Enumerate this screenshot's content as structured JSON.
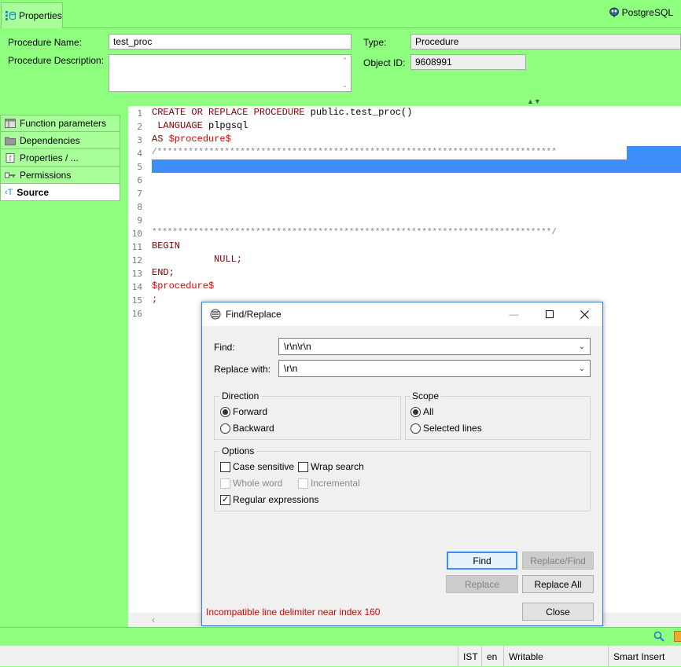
{
  "tab": {
    "label": "Properties",
    "db_name": "PostgreSQL"
  },
  "form": {
    "name_label": "Procedure Name:",
    "name_value": "test_proc",
    "desc_label": "Procedure Description:",
    "desc_value": "",
    "type_label": "Type:",
    "type_value": "Procedure",
    "oid_label": "Object ID:",
    "oid_value": "9608991"
  },
  "nav": {
    "items": [
      {
        "label": "Function parameters",
        "icon": "table-icon"
      },
      {
        "label": "Dependencies",
        "icon": "folder-icon"
      },
      {
        "label": "Properties / ...",
        "icon": "properties-icon"
      },
      {
        "label": "Permissions",
        "icon": "key-icon"
      },
      {
        "label": "Source",
        "icon": "source-icon",
        "active": true
      }
    ]
  },
  "editor": {
    "line_numbers": [
      "1",
      "2",
      "3",
      "4",
      "5",
      "6",
      "7",
      "8",
      "9",
      "10",
      "11",
      "12",
      "13",
      "14",
      "15",
      "16"
    ],
    "lines": {
      "l1_kw1": "CREATE",
      "l1_kw2": "OR",
      "l1_kw3": "REPLACE",
      "l1_kw4": "PROCEDURE",
      "l1_rest": "public.test_proc()",
      "l2_kw": "LANGUAGE",
      "l2_rest": "plpgsql",
      "l3_kw": "AS",
      "l3_dollar": "$procedure$",
      "l4": "/*****************************************************************************",
      "l10": "*****************************************************************************/",
      "l11": "BEGIN",
      "l12": "NULL;",
      "l13": "END;",
      "l14": "$procedure$",
      "l15": ";"
    }
  },
  "dialog": {
    "title": "Find/Replace",
    "find_label": "Find:",
    "find_value": "\\r\\n\\r\\n",
    "replace_label": "Replace with:",
    "replace_value": "\\r\\n",
    "direction_title": "Direction",
    "forward": "Forward",
    "backward": "Backward",
    "scope_title": "Scope",
    "all": "All",
    "selected_lines": "Selected lines",
    "options_title": "Options",
    "case_sensitive": "Case sensitive",
    "wrap_search": "Wrap search",
    "whole_word": "Whole word",
    "incremental": "Incremental",
    "regex": "Regular expressions",
    "btn_find": "Find",
    "btn_replace_find": "Replace/Find",
    "btn_replace": "Replace",
    "btn_replace_all": "Replace All",
    "btn_close": "Close",
    "error": "Incompatible line delimiter near index 160"
  },
  "status": {
    "tz": "IST",
    "locale": "en",
    "mode": "Writable",
    "insert": "Smart Insert"
  }
}
